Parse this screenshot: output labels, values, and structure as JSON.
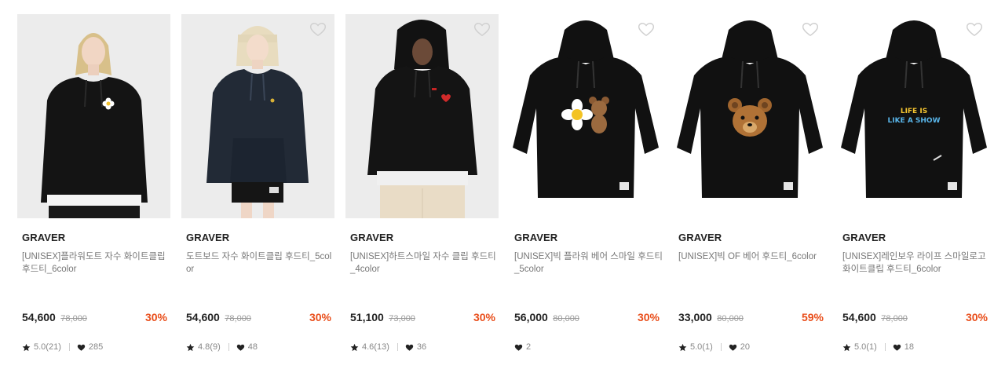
{
  "products": [
    {
      "brand": "GRAVER",
      "name": "[UNISEX]플라워도트 자수 화이트클립 후드티_6color",
      "price": "54,600",
      "original_price": "78,000",
      "discount": "30%",
      "rating": "5.0(21)",
      "likes": "285",
      "image": "model-female-blonde-black-hoodie-flower"
    },
    {
      "brand": "GRAVER",
      "name": "도트보드 자수 화이트클립 후드티_5color",
      "price": "54,600",
      "original_price": "78,000",
      "discount": "30%",
      "rating": "4.8(9)",
      "likes": "48",
      "image": "model-female-bob-navy-hoodie"
    },
    {
      "brand": "GRAVER",
      "name": "[UNISEX]하트스마일 자수 클립 후드티_4color",
      "price": "51,100",
      "original_price": "73,000",
      "discount": "30%",
      "rating": "4.6(13)",
      "likes": "36",
      "image": "model-male-black-hoodie-heart"
    },
    {
      "brand": "GRAVER",
      "name": "[UNISEX]빅 플라워 베어 스마일 후드티_5color",
      "price": "56,000",
      "original_price": "80,000",
      "discount": "30%",
      "rating": "",
      "likes": "2",
      "image": "black-hoodie-flower-bear-print"
    },
    {
      "brand": "GRAVER",
      "name": "[UNISEX]빅 OF 베어 후드티_6color",
      "price": "33,000",
      "original_price": "80,000",
      "discount": "59%",
      "rating": "5.0(1)",
      "likes": "20",
      "image": "black-hoodie-bear-face-print"
    },
    {
      "brand": "GRAVER",
      "name": "[UNISEX]레인보우 라이프 스마일로고 화이트클립 후드티_6color",
      "price": "54,600",
      "original_price": "78,000",
      "discount": "30%",
      "rating": "5.0(1)",
      "likes": "18",
      "image": "black-hoodie-rainbow-lettering",
      "print_text": [
        "LIFE IS",
        "LIKE A SHOW"
      ]
    }
  ],
  "icons": {
    "favorite": "heart-outline-icon",
    "rating": "star-icon",
    "likes": "heart-filled-icon"
  },
  "colors": {
    "discount": "#e94e1b",
    "text": "#222222",
    "muted": "#777777",
    "thumb_bg": "#ededed"
  }
}
